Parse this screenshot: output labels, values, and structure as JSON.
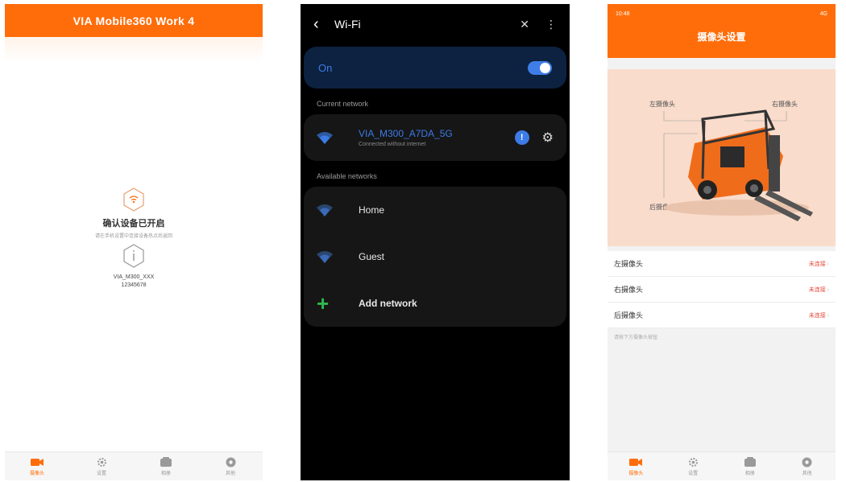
{
  "screen1": {
    "app_title": "VIA Mobile360 Work 4",
    "confirm_title": "确认设备已开启",
    "confirm_sub": "请在手机设置中连接设备热点后返回",
    "device_name": "VIA_M300_XXX",
    "device_password": "12345678",
    "tabs": [
      {
        "label": "摄像头",
        "icon": "camera-icon",
        "active": true
      },
      {
        "label": "设置",
        "icon": "settings-icon",
        "active": false
      },
      {
        "label": "相册",
        "icon": "album-icon",
        "active": false
      },
      {
        "label": "其他",
        "icon": "info-icon",
        "active": false
      }
    ]
  },
  "screen2": {
    "title": "Wi-Fi",
    "on_label": "On",
    "current_section": "Current network",
    "current": {
      "name": "VIA_M300_A7DA_5G",
      "status": "Connected without internet"
    },
    "available_section": "Available networks",
    "available": [
      {
        "name": "Home"
      },
      {
        "name": "Guest"
      }
    ],
    "add_network": "Add network"
  },
  "screen3": {
    "status_time": "10:48",
    "status_right": "4G",
    "title": "摄像头设置",
    "cam_labels": {
      "rear": "后摄像头",
      "front": "左摄像头",
      "side": "右摄像头"
    },
    "rows": [
      {
        "label": "左摄像头",
        "status": "未连接"
      },
      {
        "label": "右摄像头",
        "status": "未连接"
      },
      {
        "label": "后摄像头",
        "status": "未连接"
      }
    ],
    "hint": "请按下方摄像头按钮",
    "tabs": [
      {
        "label": "摄像头",
        "icon": "camera-icon",
        "active": true
      },
      {
        "label": "设置",
        "icon": "settings-icon",
        "active": false
      },
      {
        "label": "相册",
        "icon": "album-icon",
        "active": false
      },
      {
        "label": "其他",
        "icon": "info-icon",
        "active": false
      }
    ]
  },
  "colors": {
    "accent": "#ff6d0a",
    "wifi_blue": "#3d7be6",
    "add_green": "#2fb84e",
    "error_red": "#e64a3b"
  }
}
